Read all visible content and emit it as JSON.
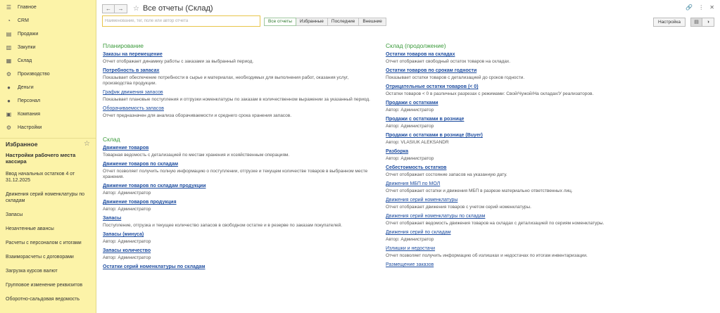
{
  "sidebar": {
    "nav": [
      {
        "icon": "home-icon",
        "glyph": "☰",
        "label": "Главное"
      },
      {
        "icon": "crm-icon",
        "glyph": "◔",
        "label": "CRM"
      },
      {
        "icon": "sales-icon",
        "glyph": "▤",
        "label": "Продажи"
      },
      {
        "icon": "purchases-icon",
        "glyph": "▥",
        "label": "Закупки"
      },
      {
        "icon": "warehouse-icon",
        "glyph": "▦",
        "label": "Склад"
      },
      {
        "icon": "production-icon",
        "glyph": "⚙",
        "label": "Производство"
      },
      {
        "icon": "money-icon",
        "glyph": "●",
        "label": "Деньги"
      },
      {
        "icon": "personnel-icon",
        "glyph": "●",
        "label": "Персонал"
      },
      {
        "icon": "company-icon",
        "glyph": "▣",
        "label": "Компания"
      },
      {
        "icon": "settings-icon",
        "glyph": "⚙",
        "label": "Настройки"
      }
    ],
    "favorites_title": "Избранное",
    "favorites": [
      {
        "label": "Настройки рабочего места кассира",
        "bold": true
      },
      {
        "label": "Ввод начальных остатков 4 от 31.12.2025",
        "bold": false
      },
      {
        "label": "Движения серий номенклатуры по складам",
        "bold": false
      },
      {
        "label": "Запасы",
        "bold": false
      },
      {
        "label": "Незачтенные авансы",
        "bold": false
      },
      {
        "label": "Расчеты с персоналом с итогами",
        "bold": false
      },
      {
        "label": "Взаиморасчеты с договорами",
        "bold": false
      },
      {
        "label": "Загрузка курсов валют",
        "bold": false
      },
      {
        "label": "Групповое изменение реквизитов",
        "bold": false
      },
      {
        "label": "Оборотно-сальдовая ведомость",
        "bold": false
      }
    ]
  },
  "header": {
    "back": "←",
    "forward": "→",
    "title": "Все отчеты (Склад)",
    "search_placeholder": "Наименование, тег, поле или автор отчета",
    "filters": [
      {
        "label": "Все отчеты",
        "active": true
      },
      {
        "label": "Избранные",
        "active": false
      },
      {
        "label": "Последние",
        "active": false
      },
      {
        "label": "Внешние",
        "active": false
      }
    ],
    "settings_label": "Настройка"
  },
  "left_sections": [
    {
      "title": "Планирование",
      "reports": [
        {
          "name": "Заказы на перемещение",
          "bold": true,
          "desc": "Отчет отображает динамику работы с заказами за выбранный период."
        },
        {
          "name": "Потребность в запасах",
          "bold": true,
          "desc": "Показывает обеспечение потребности в сырье и материалах, необходимых для выполнения работ, оказания услуг, производства продукции."
        },
        {
          "name": "График движения запасов",
          "bold": false,
          "desc": "Показывает плановые поступления и отгрузки номенклатуры по заказам в количественном выражении за указанный период."
        },
        {
          "name": "Оборачиваемость запасов",
          "bold": false,
          "desc": "Отчет предназначен для анализа оборачиваемости и среднего срока хранения запасов."
        }
      ]
    },
    {
      "title": "Склад",
      "reports": [
        {
          "name": "Движение товаров",
          "bold": true,
          "desc": "Товарная ведомость с детализацией по местам хранения и хозяйственным операциям."
        },
        {
          "name": "Движение товаров по складам",
          "bold": true,
          "desc": "Отчет позволяет получить полную информацию о поступлении, отгрузке и текущем количестве товаров в выбранном месте хранения."
        },
        {
          "name": "Движение товаров по складам продукции",
          "bold": true,
          "desc": "Автор: Администратор"
        },
        {
          "name": "Движение товаров продукция",
          "bold": true,
          "desc": "Автор: Администратор"
        },
        {
          "name": "Запасы",
          "bold": true,
          "desc": "Поступление, отгрузка и текущее количество запасов в свободном остатке и в резерве по заказам покупателей."
        },
        {
          "name": "Запасы (минуса)",
          "bold": true,
          "desc": "Автор: Администратор"
        },
        {
          "name": "Запасы количество",
          "bold": true,
          "desc": "Автор: Администратор"
        },
        {
          "name": "Остатки серий номенклатуры по складам",
          "bold": true,
          "desc": ""
        }
      ]
    }
  ],
  "right_sections": [
    {
      "title": "Склад (продолжение)",
      "reports": [
        {
          "name": "Остатки товаров на складах",
          "bold": true,
          "desc": "Отчет отображает свободный остаток товаров на складах."
        },
        {
          "name": "Остатки товаров по срокам годности",
          "bold": true,
          "desc": "Показывает остатки товаров с детализацией до сроков годности."
        },
        {
          "name": "Отрицательные остатки товаров (< 0)",
          "bold": true,
          "desc": "Остатки товаров < 0 в различных разрезах с режимами: Свой/Чужой/На складах/У реализаторов."
        },
        {
          "name": "Продажи с остатками",
          "bold": true,
          "desc": "Автор: Администратор"
        },
        {
          "name": "Продажи с остатками в рознице",
          "bold": true,
          "desc": "Автор: Администратор"
        },
        {
          "name": "Продажи с остатками в рознице (Buyer)",
          "bold": true,
          "desc": "Автор: VLASIUK ALEKSANDR"
        },
        {
          "name": "Разборка",
          "bold": true,
          "desc": "Автор: Администратор"
        },
        {
          "name": "Себестоимость остатков",
          "bold": true,
          "desc": "Отчет отображает состояние запасов на указанную дату."
        },
        {
          "name": "Движения МБП по МОЛ",
          "bold": false,
          "desc": "Отчет отображает остатки и движения МБП в разрезе материально ответственных лиц."
        },
        {
          "name": "Движения серий номенклатуры",
          "bold": false,
          "desc": "Отчет отображает движения товаров с учетом серий номенклатуры."
        },
        {
          "name": "Движения серий номенклатуры по складам",
          "bold": false,
          "desc": "Отчет отображает ведомость движения товаров на складах с детализацией по сериям номенклатуры."
        },
        {
          "name": "Движения серий по складам",
          "bold": false,
          "desc": "Автор: Администратор"
        },
        {
          "name": "Излишки и недостачи",
          "bold": false,
          "desc": "Отчет позволяет получить информацию об излишках и недостачах по итогам инвентаризации."
        },
        {
          "name": "Размещение заказов",
          "bold": false,
          "desc": ""
        }
      ]
    }
  ]
}
